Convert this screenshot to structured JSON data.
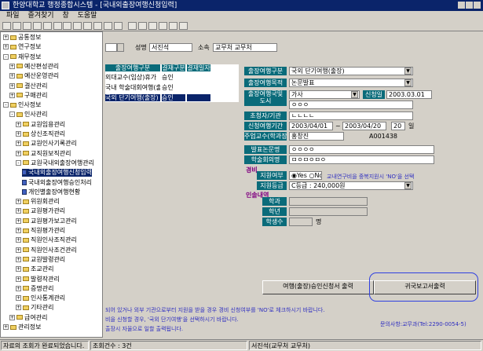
{
  "window": {
    "title": "한양대학교 행정종합시스템 - [국내외출장여행신청입력]"
  },
  "menu": [
    "파일",
    "즐겨찾기",
    "창",
    "도움말"
  ],
  "tree": [
    {
      "label": "공통정보",
      "lvl": 0,
      "box": "+"
    },
    {
      "label": "연구정보",
      "lvl": 0,
      "box": "+"
    },
    {
      "label": "재무정보",
      "lvl": 0,
      "box": "-"
    },
    {
      "label": "예산편성관리",
      "lvl": 1,
      "box": "+"
    },
    {
      "label": "예산운영관리",
      "lvl": 1,
      "box": "+"
    },
    {
      "label": "결산관리",
      "lvl": 1,
      "box": "+"
    },
    {
      "label": "구매관리",
      "lvl": 1,
      "box": "+"
    },
    {
      "label": "인사정보",
      "lvl": 0,
      "box": "-"
    },
    {
      "label": "인사관리",
      "lvl": 1,
      "box": "-"
    },
    {
      "label": "교원임용관리",
      "lvl": 2,
      "box": "+"
    },
    {
      "label": "상신조직관리",
      "lvl": 2,
      "box": "+"
    },
    {
      "label": "교원인사기록관리",
      "lvl": 2,
      "box": "+"
    },
    {
      "label": "교직원보직관리",
      "lvl": 2,
      "box": "+"
    },
    {
      "label": "교원국내외출장여행관리",
      "lvl": 2,
      "box": "-"
    },
    {
      "label": "국내외출장여행신청입력",
      "lvl": 3,
      "box": "",
      "sel": true
    },
    {
      "label": "국내외출장여행승인처리",
      "lvl": 3,
      "box": ""
    },
    {
      "label": "개인별출장여행현황",
      "lvl": 3,
      "box": ""
    },
    {
      "label": "위원회관리",
      "lvl": 2,
      "box": "+"
    },
    {
      "label": "교원평가관리",
      "lvl": 2,
      "box": "+"
    },
    {
      "label": "교원평가보고관리",
      "lvl": 2,
      "box": "+"
    },
    {
      "label": "직원평가관리",
      "lvl": 2,
      "box": "+"
    },
    {
      "label": "직원인사조직관리",
      "lvl": 2,
      "box": "+"
    },
    {
      "label": "직원인사조건관리",
      "lvl": 2,
      "box": "+"
    },
    {
      "label": "교원발령관리",
      "lvl": 2,
      "box": "+"
    },
    {
      "label": "조교관리",
      "lvl": 2,
      "box": "+"
    },
    {
      "label": "발령작관리",
      "lvl": 2,
      "box": "+"
    },
    {
      "label": "증명관리",
      "lvl": 2,
      "box": "+"
    },
    {
      "label": "인사통계관리",
      "lvl": 2,
      "box": "+"
    },
    {
      "label": "기타관리",
      "lvl": 2,
      "box": "+"
    },
    {
      "label": "급여관리",
      "lvl": 1,
      "box": "+"
    },
    {
      "label": "관리정보",
      "lvl": 0,
      "box": "+"
    }
  ],
  "header": {
    "name_label": "성명",
    "name_value": "서진석",
    "dept_label": "소속",
    "dept_value": "교무처 교무처"
  },
  "grid": {
    "headers": [
      "출장여행구분",
      "결재구분",
      "결재일자"
    ],
    "rows": [
      [
        "외대교수(임상)휴가",
        "승인",
        ""
      ],
      [
        "국내 학술대회여행(출",
        "승인",
        ""
      ],
      [
        "국외 단기여행(출장)",
        "승인",
        ""
      ]
    ]
  },
  "form": {
    "trip_type_label": "출장여행구분",
    "trip_type": "국외 단기여행(출장)",
    "purpose_label": "출장여행목적",
    "purpose": "논문발표",
    "dest_label": "출장여행국및 도시",
    "dest": "가사",
    "request_label": "신청일",
    "request_date": "2003.03.01",
    "dest2": "ㅇㅇㅇ",
    "org_label": "초청자/기관",
    "org": "ㄴㄴㄴㄴ",
    "period_label": "신청여행기간",
    "period_from": "2003/04/01",
    "period_sep": "~",
    "period_to": "2003/04/20",
    "days": "20",
    "days_unit": "일",
    "sub_label": "주업교수(학과장,학부장)",
    "sub_name": "홍창진",
    "sub_code": "A001438",
    "paper_label": "발표논문명",
    "paper": "ㅇㅇㅇㅇ",
    "conf_label": "학술회의명",
    "conf": "ㅁㅇㅁㅇㅁㅇ",
    "cost_section": "경비",
    "support_label": "지원여부",
    "yes": "Yes",
    "no": "No",
    "support_note": "교내연구비을 중복지원시 'NO'을 선택",
    "grade_label": "지원등급",
    "grade": "C등급 : 240,000원",
    "leave_section": "인솔내역",
    "school_label": "학과",
    "year_label": "학년",
    "count_label": "학생수",
    "count_unit": "명"
  },
  "buttons": {
    "apply_print": "여행(출장)승인신청서 출력",
    "report_print": "귀국보고서출력"
  },
  "notes": [
    "되어 있거나 외부 기관으로부터 지원을 받을 경우 경비 신청여부를 'NO'로 체크하시기 바랍니다.",
    "비을 신청할 경우, '국외 단기여행'을 선택하시기 바랍니다.",
    "출장시 자율으로 일할 출력됩니다.",
    "문의사항:교무과(Tel:2290-0054-5)"
  ],
  "status": {
    "msg": "자료의 조회가 완료되었습니다.",
    "count": "조회건수 : 3건",
    "user": "서진석(교무처 교무처)"
  }
}
